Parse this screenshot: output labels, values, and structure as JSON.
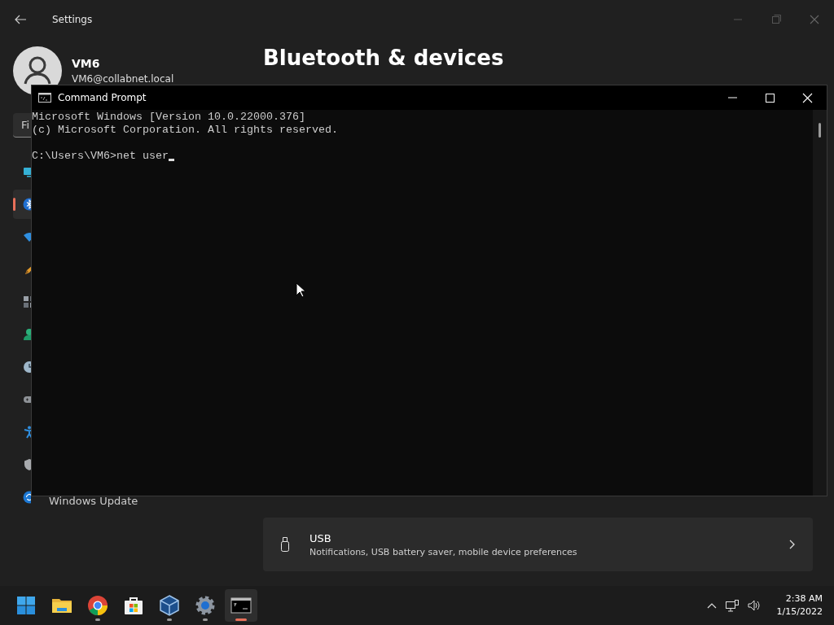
{
  "settings_window": {
    "title": "Settings",
    "user": {
      "name": "VM6",
      "email": "VM6@collabnet.local"
    },
    "search": {
      "value": "Fi"
    },
    "nav_items": [
      {
        "selected": false
      },
      {
        "selected": true
      },
      {
        "selected": false
      },
      {
        "selected": false
      },
      {
        "selected": false
      },
      {
        "selected": false
      },
      {
        "selected": false
      },
      {
        "selected": false
      },
      {
        "selected": false
      },
      {
        "selected": false
      },
      {
        "selected": false,
        "label": "Windows Update"
      }
    ],
    "page_title": "Bluetooth & devices",
    "cards": [
      {
        "title": "USB",
        "description": "Notifications, USB battery saver, mobile device preferences"
      }
    ]
  },
  "command_prompt": {
    "title": "Command Prompt",
    "banner": [
      "Microsoft Windows [Version 10.0.22000.376]",
      "(c) Microsoft Corporation. All rights reserved."
    ],
    "prompt": "C:\\Users\\VM6>",
    "command": "net user",
    "cursor": true
  },
  "taskbar": {
    "apps": [
      {
        "running": false,
        "active": false
      },
      {
        "running": false,
        "active": false
      },
      {
        "running": true,
        "active": false
      },
      {
        "running": false,
        "active": false
      },
      {
        "running": true,
        "active": false
      },
      {
        "running": true,
        "active": false
      },
      {
        "running": true,
        "active": true
      }
    ],
    "clock": {
      "time": "2:38 AM",
      "date": "1/15/2022"
    }
  }
}
